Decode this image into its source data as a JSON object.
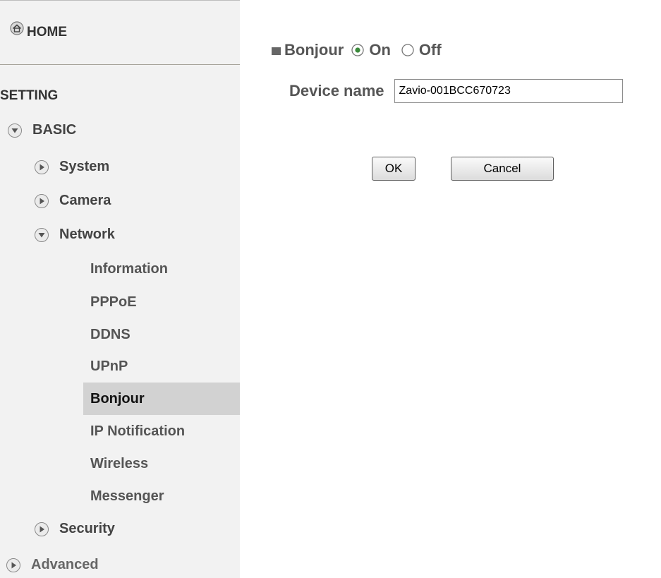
{
  "sidebar": {
    "home_label": "HOME",
    "section_title": "SETTING",
    "basic": {
      "label": "BASIC"
    },
    "system": {
      "label": "System"
    },
    "camera": {
      "label": "Camera"
    },
    "network": {
      "label": "Network"
    },
    "network_items": [
      {
        "label": "Information"
      },
      {
        "label": "PPPoE"
      },
      {
        "label": "DDNS"
      },
      {
        "label": "UPnP"
      },
      {
        "label": "Bonjour",
        "active": true
      },
      {
        "label": "IP Notification"
      },
      {
        "label": "Wireless"
      },
      {
        "label": "Messenger"
      }
    ],
    "security": {
      "label": "Security"
    },
    "advanced": {
      "label": "Advanced"
    }
  },
  "bonjour": {
    "title": "Bonjour",
    "on_label": "On",
    "off_label": "Off",
    "selected": "On",
    "device_name_label": "Device name",
    "device_name_value": "Zavio-001BCC670723"
  },
  "buttons": {
    "ok": "OK",
    "cancel": "Cancel"
  },
  "colors": {
    "sidebar_bg": "#f2f2f2",
    "active_item_bg": "#d2d2d2",
    "text": "#555555"
  }
}
